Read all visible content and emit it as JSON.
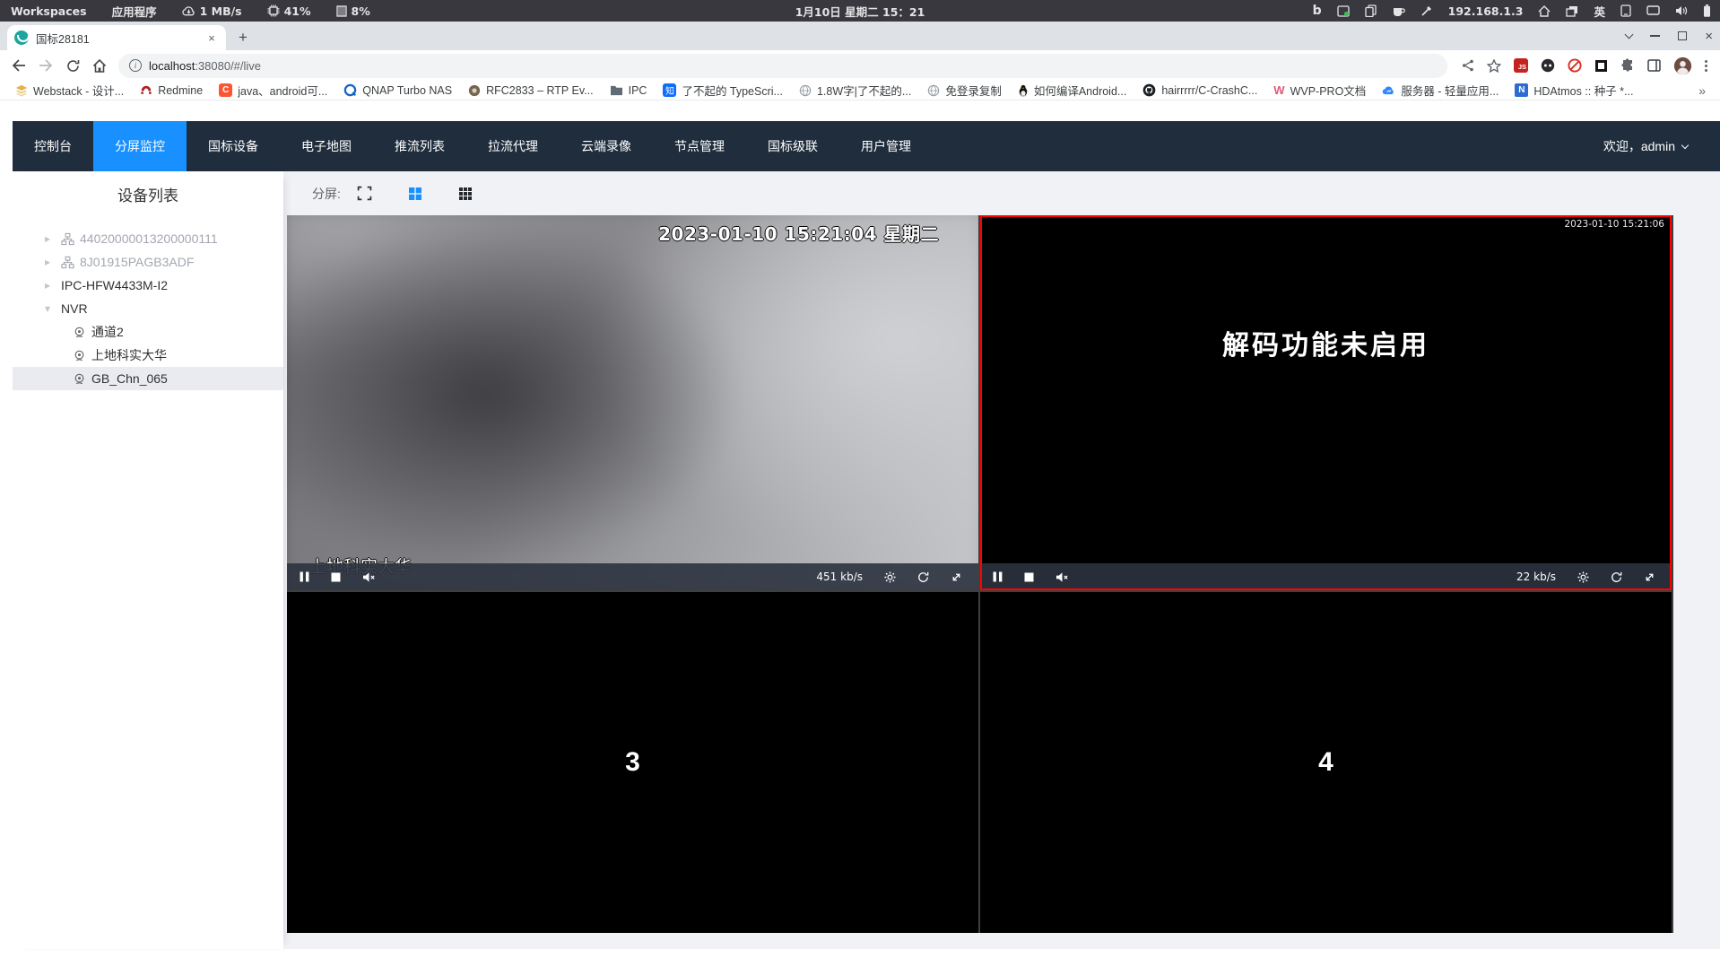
{
  "colors": {
    "accent": "#1890ff",
    "nav_bg": "#1f2d3d",
    "selected_border": "#fd0100",
    "controlbar": "#2b333f",
    "favicon_teal": "#1ea5a0"
  },
  "glyphs": {
    "bing": "b",
    "js": "JS",
    "zhihu": "知",
    "csdn": "C",
    "wvp": "W",
    "hdatmos": "N",
    "caret_collapsed": "▸",
    "caret_expanded": "▾",
    "new_tab": "+",
    "tab_close": "×",
    "win_close": "×",
    "bm_close_x": "✕"
  },
  "system_bar": {
    "workspaces": "Workspaces",
    "applications": "应用程序",
    "net_speed": "1 MB/s",
    "cpu": "41%",
    "memory": "8%",
    "clock": "1月10日 星期二 15：21",
    "ip": "192.168.1.3",
    "input_method": "英"
  },
  "browser": {
    "tab_title": "国标28181",
    "url_host": "localhost",
    "url_rest": ":38080/#/live",
    "bookmarks": [
      {
        "label": "Webstack - 设计..."
      },
      {
        "label": "Redmine"
      },
      {
        "label": "java、android可..."
      },
      {
        "label": "QNAP Turbo NAS"
      },
      {
        "label": "RFC2833 – RTP Ev..."
      },
      {
        "label": "IPC"
      },
      {
        "label": "了不起的 TypeScri..."
      },
      {
        "label": "1.8W字|了不起的..."
      },
      {
        "label": "免登录复制"
      },
      {
        "label": "如何编译Android..."
      },
      {
        "label": "hairrrrr/C-CrashC..."
      },
      {
        "label": "WVP-PRO文档"
      },
      {
        "label": "服务器 - 轻量应用..."
      },
      {
        "label": "HDAtmos :: 种子 *..."
      }
    ],
    "bookmarks_overflow": "»"
  },
  "app": {
    "nav": [
      {
        "label": "控制台"
      },
      {
        "label": "分屏监控"
      },
      {
        "label": "国标设备"
      },
      {
        "label": "电子地图"
      },
      {
        "label": "推流列表"
      },
      {
        "label": "拉流代理"
      },
      {
        "label": "云端录像"
      },
      {
        "label": "节点管理"
      },
      {
        "label": "国标级联"
      },
      {
        "label": "用户管理"
      }
    ],
    "welcome": "欢迎，admin",
    "sidebar": {
      "title": "设备列表",
      "tree": [
        {
          "label": "44020000013200000111"
        },
        {
          "label": "8J01915PAGB3ADF"
        },
        {
          "label": "IPC-HFW4433M-I2"
        },
        {
          "label": "NVR"
        },
        {
          "label": "通道2"
        },
        {
          "label": "上地科实大华"
        },
        {
          "label": "GB_Chn_065"
        }
      ]
    },
    "toolbar": {
      "label": "分屏:"
    },
    "players": [
      {
        "osd": "2023-01-10 15:21:04 星期二",
        "name": "上地科实大华",
        "bitrate": "451 kb/s"
      },
      {
        "osd": "2023-01-10 15:21:06",
        "message": "解码功能未启用",
        "bitrate": "22 kb/s"
      },
      {
        "num": "3"
      },
      {
        "num": "4"
      }
    ]
  }
}
